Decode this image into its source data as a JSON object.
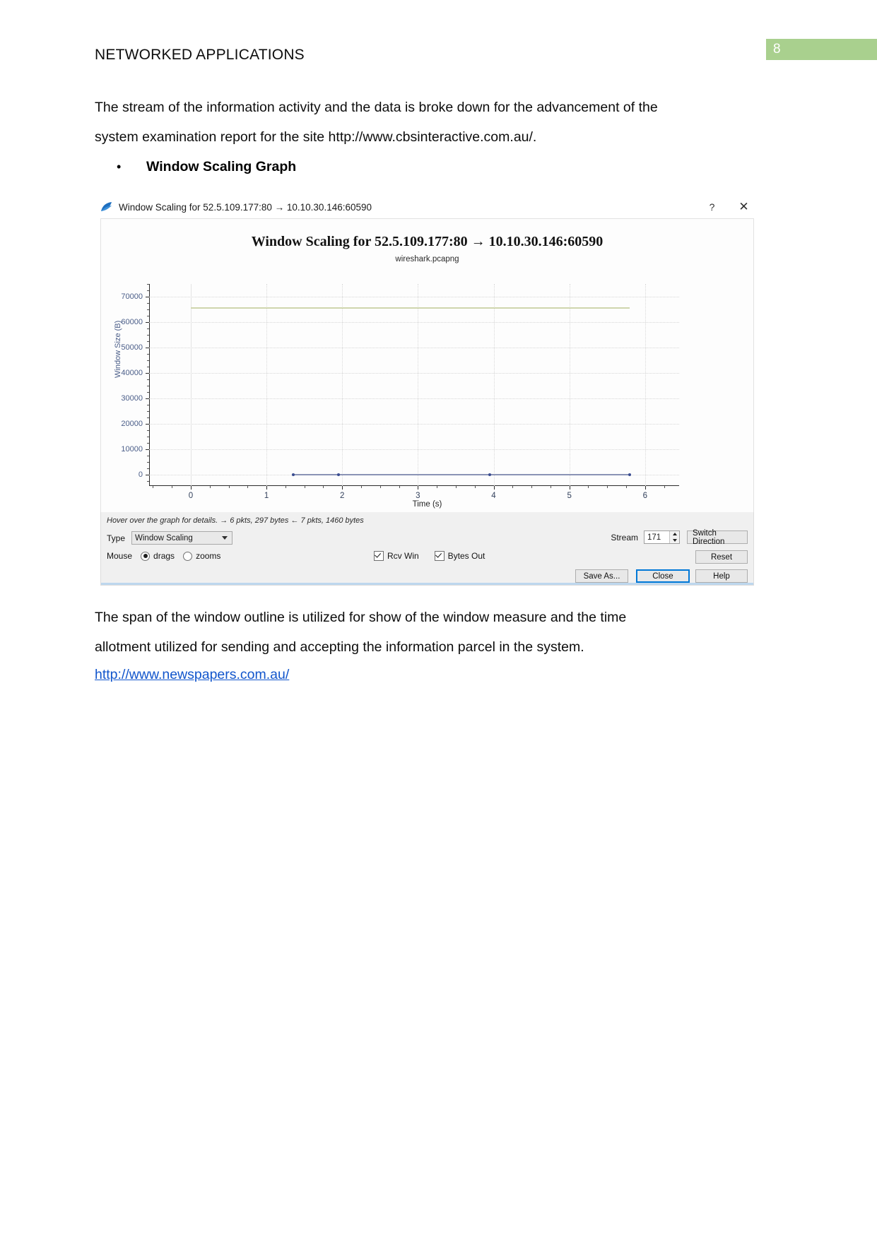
{
  "document": {
    "header_title": "NETWORKED APPLICATIONS",
    "page_number": "8",
    "badge_color": "#a9d08e",
    "paragraph_intro": "The stream of the information activity and the data is broke down for the advancement of the system examination report for the site http://www.cbsinteractive.com.au/.",
    "bullet_marker": "•",
    "bullet_label": "Window Scaling Graph",
    "paragraph_after": "The span of the window outline is utilized for show of the window measure and the time allotment utilized for sending and accepting the information parcel in the system.",
    "link_text": "http://www.newspapers.com.au/",
    "link_color": "#1155cc"
  },
  "wireshark_window": {
    "titlebar": {
      "app_icon": "wireshark-fin-icon",
      "title": "Window Scaling for 52.5.109.177:80 → 10.10.30.146:60590",
      "help_button": "?",
      "close_button": "✕"
    },
    "panel": {
      "hover_hint": "Hover over the graph for details. → 6 pkts, 297 bytes ← 7 pkts, 1460 bytes",
      "type_label": "Type",
      "type_value": "Window Scaling",
      "mouse_label": "Mouse",
      "mouse_drags_label": "drags",
      "mouse_zooms_label": "zooms",
      "mouse_selected": "drags",
      "checkbox_rcv_win_label": "Rcv Win",
      "checkbox_rcv_win_checked": true,
      "checkbox_bytes_out_label": "Bytes Out",
      "checkbox_bytes_out_checked": true,
      "stream_label": "Stream",
      "stream_value": "171",
      "switch_direction_label": "Switch Direction",
      "reset_label": "Reset",
      "save_as_label": "Save As...",
      "close_label": "Close",
      "help_label": "Help"
    }
  },
  "chart_data": {
    "type": "line",
    "title": "Window Scaling for 52.5.109.177:80 → 10.10.30.146:60590",
    "subtitle": "wireshark.pcapng",
    "xlabel": "Time (s)",
    "ylabel": "Window Size (B)",
    "xlim": [
      -0.55,
      6.45
    ],
    "ylim": [
      -4500,
      75000
    ],
    "grid": true,
    "legend_position": "none",
    "xticks": [
      "0",
      "1",
      "2",
      "3",
      "4",
      "5",
      "6"
    ],
    "xtick_values": [
      0,
      1,
      2,
      3,
      4,
      5,
      6
    ],
    "yticks": [
      "0",
      "10000",
      "20000",
      "30000",
      "40000",
      "50000",
      "60000",
      "70000"
    ],
    "ytick_values": [
      0,
      10000,
      20000,
      30000,
      40000,
      50000,
      60000,
      70000
    ],
    "series": [
      {
        "name": "Rcv Win",
        "color": "#cfd6ae",
        "x": [
          0.0,
          1.95,
          5.8
        ],
        "values": [
          65535,
          65535,
          65535
        ]
      },
      {
        "name": "Bytes Out",
        "color": "#8a93b5",
        "x": [
          1.35,
          1.95,
          3.95,
          5.8
        ],
        "values": [
          0,
          0,
          0,
          0
        ]
      }
    ],
    "markers": [
      {
        "x": 1.35,
        "y": 0
      },
      {
        "x": 1.95,
        "y": 0
      },
      {
        "x": 3.95,
        "y": 0
      },
      {
        "x": 5.8,
        "y": 0
      }
    ]
  }
}
